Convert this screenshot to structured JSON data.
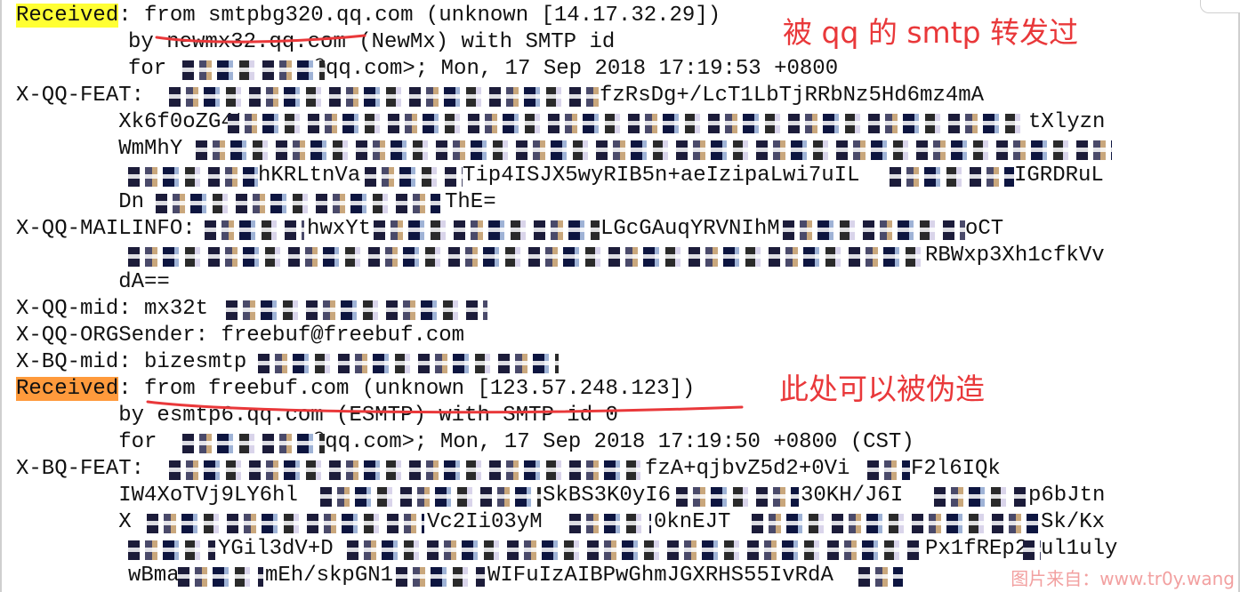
{
  "header_lines": [
    {
      "label": "Received",
      "rest": ": from smtpbg320.qq.com (unknown [14.17.32.29])"
    },
    {
      "indent": "        ",
      "rest": "by newmx32.qq.com (NewMx) with SMTP id"
    },
    {
      "indent": "        ",
      "rest": "for ",
      "after_redact": "@qq.com>; Mon, 17 Sep 2018 17:19:53 +0800"
    },
    {
      "rest": "X-QQ-FEAT: ",
      "tail": "fzRsDg+/LcT1LbTjRRbNz5Hd6mz4mA"
    },
    {
      "rest": "        Xk6f0oZG4t",
      "tail": "tXlyzn"
    },
    {
      "rest": "        WmMhY",
      "tail": ""
    },
    {
      "rest": "        ",
      "mid": "hKRLtnVa",
      "tail": "Tip4ISJX5wyRIB5n+aeIzipaLwi7uIL",
      "tail2": "IGRDRuL"
    },
    {
      "rest": "        Dn",
      "tail": "ThE="
    },
    {
      "rest": "X-QQ-MAILINFO:",
      "tail": "hwxYt",
      "tail2": "LGcGAuqYRVNIhM",
      "tail3": "oCT"
    },
    {
      "rest": "        ",
      "tail": "RBWxp3Xh1cfkVv"
    },
    {
      "rest": "        dA=="
    },
    {
      "rest": "X-QQ-mid: mx32t"
    },
    {
      "rest": "X-QQ-ORGSender: freebuf@freebuf.com"
    },
    {
      "rest": "X-BQ-mid: bizesmtp"
    },
    {
      "label": "Received",
      "rest": ": from freebuf.com (unknown [123.57.248.123])"
    },
    {
      "rest": "        by esmtp6.qq.com (ESMTP) with SMTP id 0"
    },
    {
      "rest": "        for ",
      "after_redact": "@qq.com>; Mon, 17 Sep 2018 17:19:50 +0800 (CST)"
    },
    {
      "rest": "X-BQ-FEAT: ",
      "tail": "fzA+qjbvZ5d2+0Vi",
      "tail2": "F2l6IQk"
    },
    {
      "rest": "        IW4XoTVj9LY6hl",
      "tail": "SkBS3K0yI6",
      "tail2": "30KH/J6I",
      "tail3": "p6bJtn"
    },
    {
      "rest": "        X",
      "tail": "Vc2Ii03yM",
      "tail2": "0knEJT",
      "tail3": "Sk/Kx"
    },
    {
      "rest": "        ",
      "tail": "YGil3dV+D",
      "tail2": "Px1fREp2x",
      "tail3": "ul1uly"
    },
    {
      "rest": "        ",
      "tail": "wBma",
      "tail2": "mEh/skpGN1",
      "tail3": "WIFuIzAIBPwGhmJGXRHS55IvRdA"
    }
  ],
  "annotations": {
    "note_top": "被 qq 的 smtp 转发过",
    "note_bottom": "此处可以被伪造",
    "accent": "#e9383a",
    "highlight_first": "#ffff33",
    "highlight_second": "#ff9a3c"
  },
  "watermark": "图片来自：www.tr0y.wang"
}
